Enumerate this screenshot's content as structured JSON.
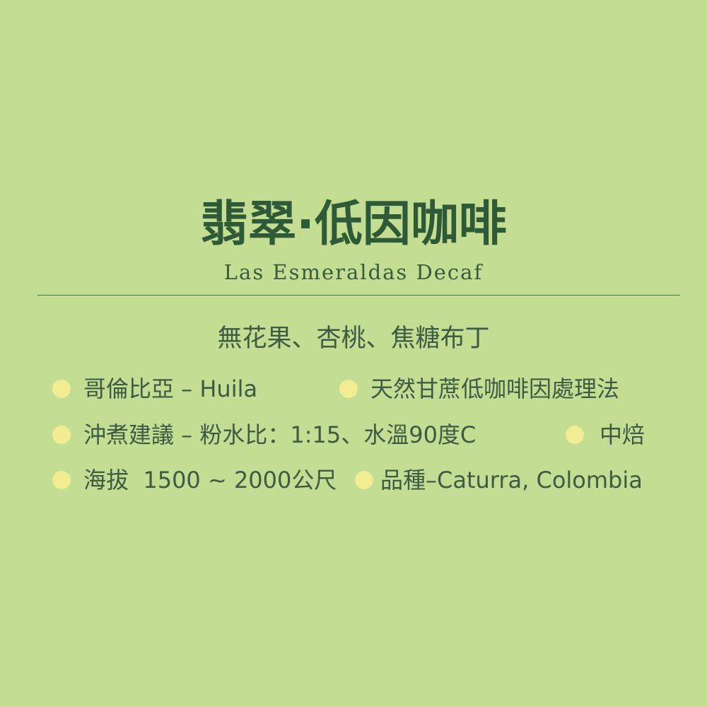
{
  "title": "翡翠·低因咖啡",
  "subtitle": "Las Esmeraldas Decaf",
  "flavor_notes": "無花果、杏桃、焦糖布丁",
  "details": [
    {
      "text": "哥倫比亞 – Huila",
      "icon": "dot-icon"
    },
    {
      "text": "天然甘蔗低咖啡因處理法",
      "icon": "dot-icon"
    },
    {
      "text": "沖煮建議 – 粉水比：1:15、水溫90度C",
      "icon": "dot-icon"
    },
    {
      "text": "中焙",
      "icon": "dot-icon"
    },
    {
      "text": "海拔  1500 ~ 2000公尺",
      "icon": "dot-icon"
    },
    {
      "text": "品種–Caturra, Colombia",
      "icon": "dot-icon"
    }
  ],
  "colors": {
    "background": "#c3de93",
    "title": "#2f5a37",
    "text": "#3f5a43",
    "divider": "#3c7a4a",
    "bullet": "#f2ec92"
  }
}
